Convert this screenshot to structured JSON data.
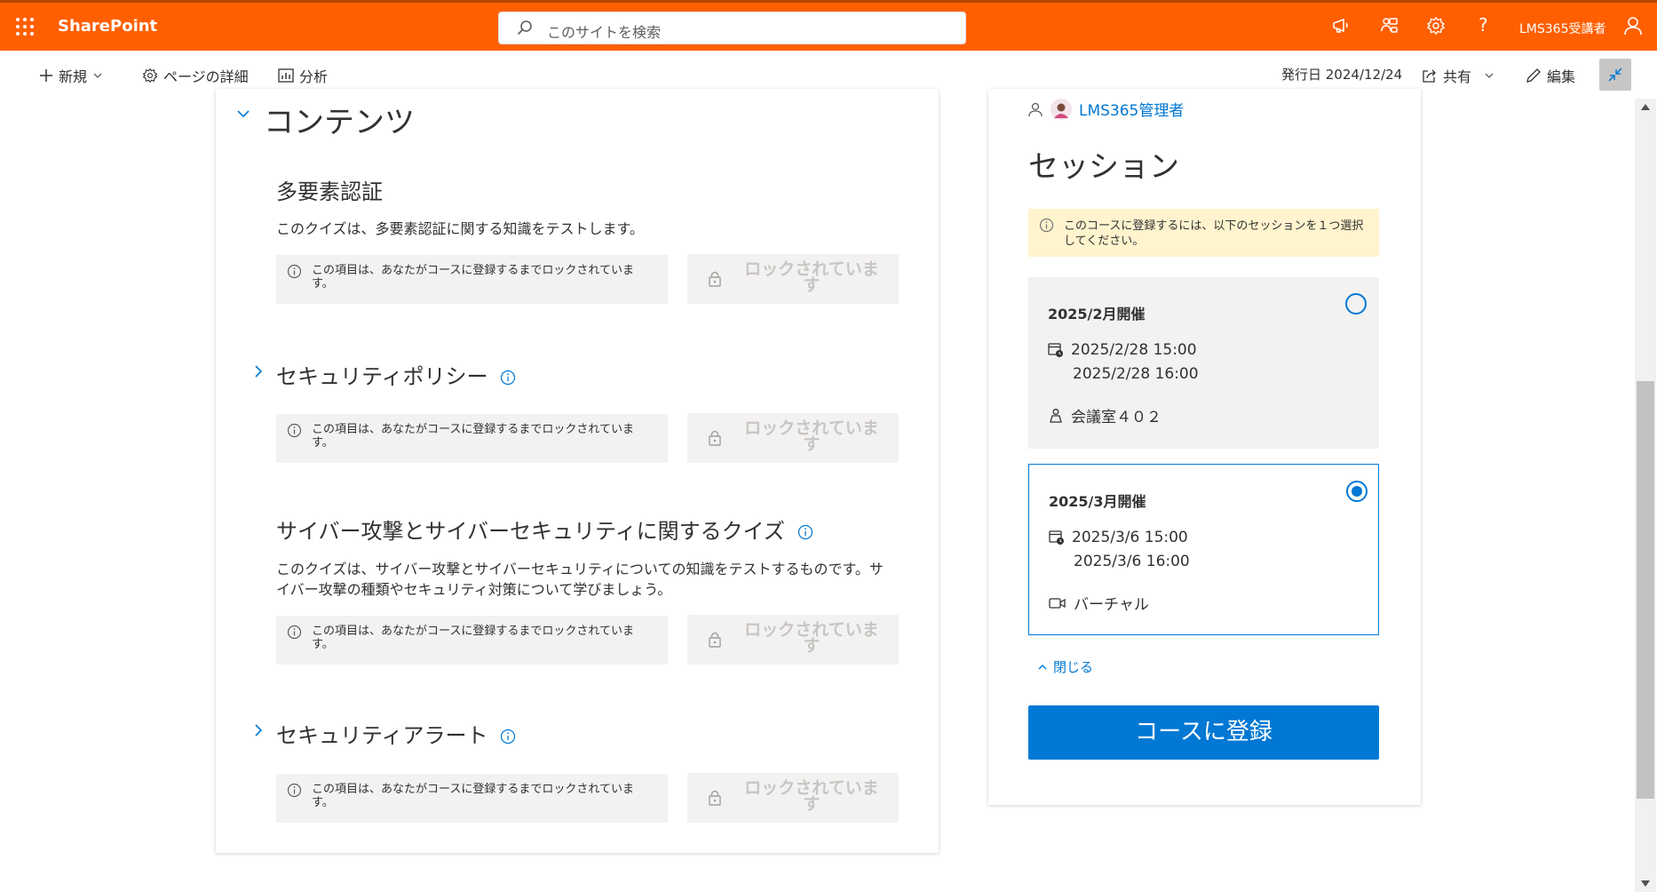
{
  "topbar": {
    "app_name": "SharePoint",
    "search_placeholder": "このサイトを検索",
    "user_name": "LMS365受講者",
    "help_label": "?"
  },
  "commandbar": {
    "new_label": "新規",
    "page_details_label": "ページの詳細",
    "analytics_label": "分析",
    "published_label": "発行日 2024/12/24",
    "share_label": "共有",
    "edit_label": "編集"
  },
  "content": {
    "section_title": "コンテンツ",
    "items": [
      {
        "title": "多要素認証",
        "description": "このクイズは、多要素認証に関する知識をテストします。",
        "lock_info": "この項目は、あなたがコースに登録するまでロックされています。",
        "lock_button": "ロックされています"
      },
      {
        "title": "セキュリティポリシー",
        "lock_info": "この項目は、あなたがコースに登録するまでロックされています。",
        "lock_button": "ロックされています"
      },
      {
        "title": "サイバー攻撃とサイバーセキュリティに関するクイズ",
        "description": "このクイズは、サイバー攻撃とサイバーセキュリティについての知識をテストするものです。サイバー攻撃の種類やセキュリティ対策について学びましょう。",
        "lock_info": "この項目は、あなたがコースに登録するまでロックされています。",
        "lock_button": "ロックされています"
      },
      {
        "title": "セキュリティアラート",
        "lock_info": "この項目は、あなたがコースに登録するまでロックされています。",
        "lock_button": "ロックされています"
      }
    ]
  },
  "sidebar": {
    "author": "LMS365管理者",
    "title": "セッション",
    "notice": "このコースに登録するには、以下のセッションを１つ選択してください。",
    "sessions": [
      {
        "name": "2025/2月開催",
        "start": "2025/2/28 15:00",
        "end": "2025/2/28 16:00",
        "location": "会議室４０２",
        "location_icon": "person-location-icon",
        "selected": false
      },
      {
        "name": "2025/3月開催",
        "start": "2025/3/6 15:00",
        "end": "2025/3/6 16:00",
        "location": "バーチャル",
        "location_icon": "video-icon",
        "selected": true
      }
    ],
    "close_label": "閉じる",
    "enroll_label": "コースに登録"
  },
  "colors": {
    "suite_bar": "#ff5f00",
    "accent": "#0078d4",
    "notice_bg": "#fff4ce",
    "locked_bg": "#f3f2f1"
  }
}
